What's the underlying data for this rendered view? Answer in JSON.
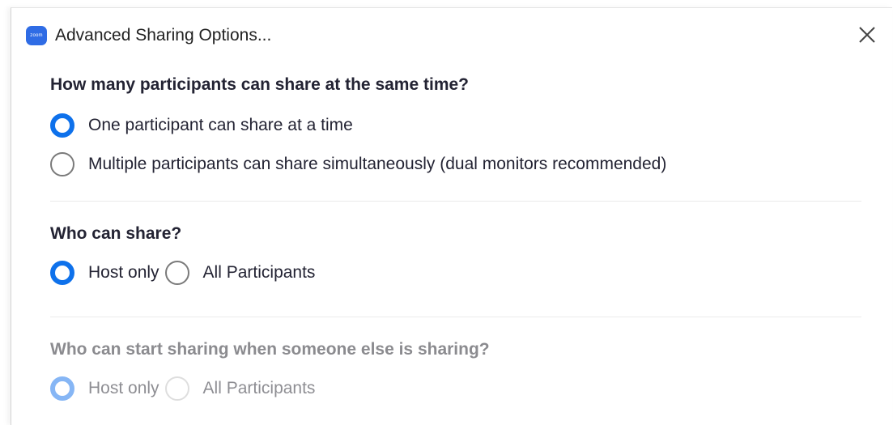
{
  "window": {
    "title": "Advanced Sharing Options...",
    "app_icon_text": "zoom",
    "close_icon": "close-icon"
  },
  "sections": [
    {
      "heading": "How many participants can share at the same time?",
      "disabled": false,
      "options": [
        {
          "label": "One participant can share at a time",
          "checked": true
        },
        {
          "label": "Multiple participants can share simultaneously (dual monitors recommended)",
          "checked": false
        }
      ]
    },
    {
      "heading": "Who can share?",
      "disabled": false,
      "options": [
        {
          "label": "Host only",
          "checked": true
        },
        {
          "label": "All Participants",
          "checked": false
        }
      ]
    },
    {
      "heading": "Who can start sharing when someone else is sharing?",
      "disabled": true,
      "options": [
        {
          "label": "Host only",
          "checked": true
        },
        {
          "label": "All Participants",
          "checked": false
        }
      ]
    }
  ],
  "colors": {
    "accent": "#0e71eb",
    "accent_disabled": "#86b6f5",
    "text": "#232333",
    "text_disabled": "#8e8e93"
  }
}
